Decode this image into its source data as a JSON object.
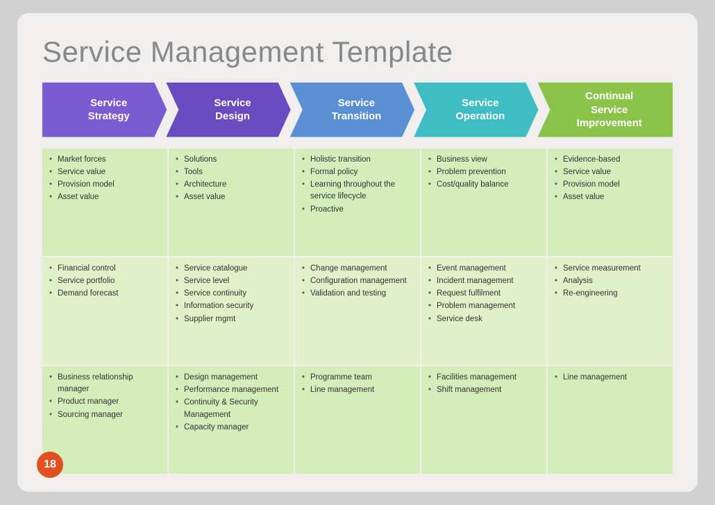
{
  "slide": {
    "title": "Service Management Template",
    "page_number": "18"
  },
  "banners": [
    {
      "id": "col1",
      "label": "Service\nStrategy",
      "color": "#7a5cd1"
    },
    {
      "id": "col2",
      "label": "Service\nDesign",
      "color": "#6a4cc0"
    },
    {
      "id": "col3",
      "label": "Service\nTransition",
      "color": "#5b8fd4"
    },
    {
      "id": "col4",
      "label": "Service\nOperation",
      "color": "#3fbcc4"
    },
    {
      "id": "col5",
      "label": "Continual\nService\nImprovement",
      "color": "#8bc34a"
    }
  ],
  "rows": [
    {
      "id": "row1",
      "bg": "#d4edba",
      "cells": [
        [
          "Market forces",
          "Service value",
          "Provision model",
          "Asset value"
        ],
        [
          "Solutions",
          "Tools",
          "Architecture",
          "Asset value"
        ],
        [
          "Holistic transition",
          "Formal policy",
          "Learning throughout the service lifecycle",
          "Proactive"
        ],
        [
          "Business view",
          "Problem prevention",
          "Cost/quality balance"
        ],
        [
          "Evidence-based",
          "Service value",
          "Provision model",
          "Asset value"
        ]
      ]
    },
    {
      "id": "row2",
      "bg": "#e0f0c8",
      "cells": [
        [
          "Financial control",
          "Service portfolio",
          "Demand forecast"
        ],
        [
          "Service catalogue",
          "Service level",
          "Service continuity",
          "Information security",
          "Supplier mgmt"
        ],
        [
          "Change management",
          "Configuration management",
          "Validation and testing"
        ],
        [
          "Event management",
          "Incident management",
          "Request fulfilment",
          "Problem management",
          "Service desk"
        ],
        [
          "Service measurement",
          "Analysis",
          "Re-engineering"
        ]
      ]
    },
    {
      "id": "row3",
      "bg": "#d4edba",
      "cells": [
        [
          "Business relationship manager",
          "Product manager",
          "Sourcing manager"
        ],
        [
          "Design management",
          "Performance management",
          "Continuity & Security Management",
          "Capacity manager"
        ],
        [
          "Programme team",
          "Line management"
        ],
        [
          "Facilities management",
          "Shift management"
        ],
        [
          "Line management"
        ]
      ]
    }
  ]
}
